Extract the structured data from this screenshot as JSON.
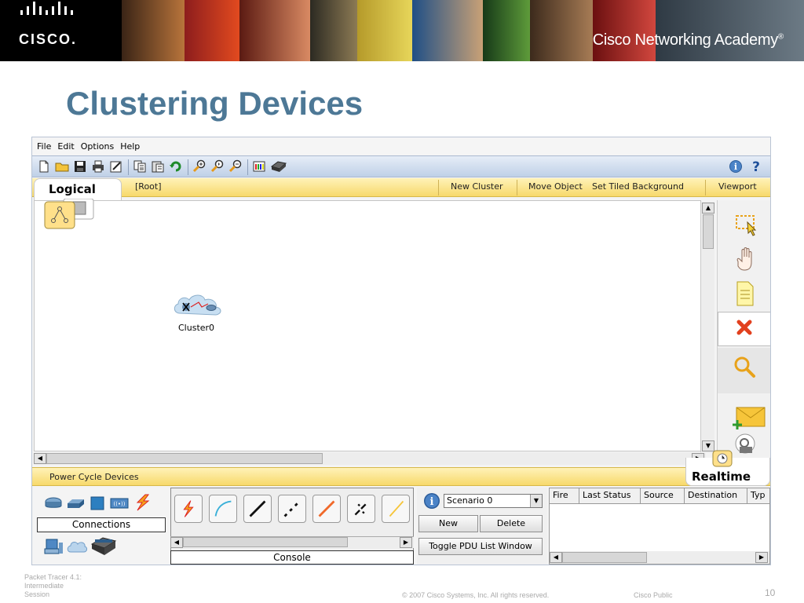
{
  "banner": {
    "logo_text": "CISCO.",
    "academy_text": "Cisco Networking Academy",
    "academy_mark": "®"
  },
  "slide": {
    "title": "Clustering Devices"
  },
  "menu": [
    "File",
    "Edit",
    "Options",
    "Help"
  ],
  "toolbar": {
    "icons": [
      "new-file-icon",
      "open-folder-icon",
      "save-icon",
      "print-icon",
      "activity-wizard-icon",
      "copy-icon",
      "paste-icon",
      "undo-icon",
      "zoom-in-icon",
      "zoom-reset-icon",
      "zoom-out-icon",
      "palette-icon",
      "custom-device-icon"
    ],
    "info_icon": "info-icon",
    "help_icon": "help-icon"
  },
  "logical_bar": {
    "tab_label": "Logical",
    "root": "[Root]",
    "new_cluster": "New Cluster",
    "move_object": "Move Object",
    "set_tiled_background": "Set Tiled Background",
    "viewport": "Viewport"
  },
  "workspace": {
    "cluster_label": "Cluster0"
  },
  "right_tools": [
    "select-icon",
    "move-hand-icon",
    "note-icon",
    "delete-icon",
    "inspect-icon",
    "add-simple-pdu-icon",
    "add-complex-pdu-icon"
  ],
  "realtime": {
    "label": "Realtime"
  },
  "power_bar": {
    "label": "Power Cycle Devices"
  },
  "device_panel": {
    "category_label": "Connections",
    "categories": [
      "routers-icon",
      "switches-icon",
      "hubs-icon",
      "wireless-icon",
      "connections-icon"
    ],
    "sub_categories": [
      "end-devices-icon",
      "wan-emulation-icon",
      "custom-devices-icon"
    ]
  },
  "cable_panel": {
    "label": "Console",
    "cables": [
      "auto-cable-icon",
      "console-cable-icon",
      "straight-through-cable-icon",
      "crossover-cable-icon",
      "fiber-cable-icon",
      "phone-cable-icon",
      "coaxial-cable-icon"
    ]
  },
  "scenario_panel": {
    "selected": "Scenario 0",
    "new_button": "New",
    "delete_button": "Delete",
    "toggle_button": "Toggle PDU List Window"
  },
  "pdu_list": {
    "columns": [
      "Fire",
      "Last Status",
      "Source",
      "Destination",
      "Typ"
    ]
  },
  "footer": {
    "line1": "Packet Tracer 4.1:",
    "line2": "Intermediate",
    "line3": "Session",
    "copyright": "© 2007 Cisco Systems, Inc. All rights reserved.",
    "public": "Cisco Public",
    "page": "10"
  },
  "colors": {
    "title": "#4d7896",
    "yellow_bar": "#f7d96b",
    "toolbar_blue": "#bfd0e7"
  }
}
